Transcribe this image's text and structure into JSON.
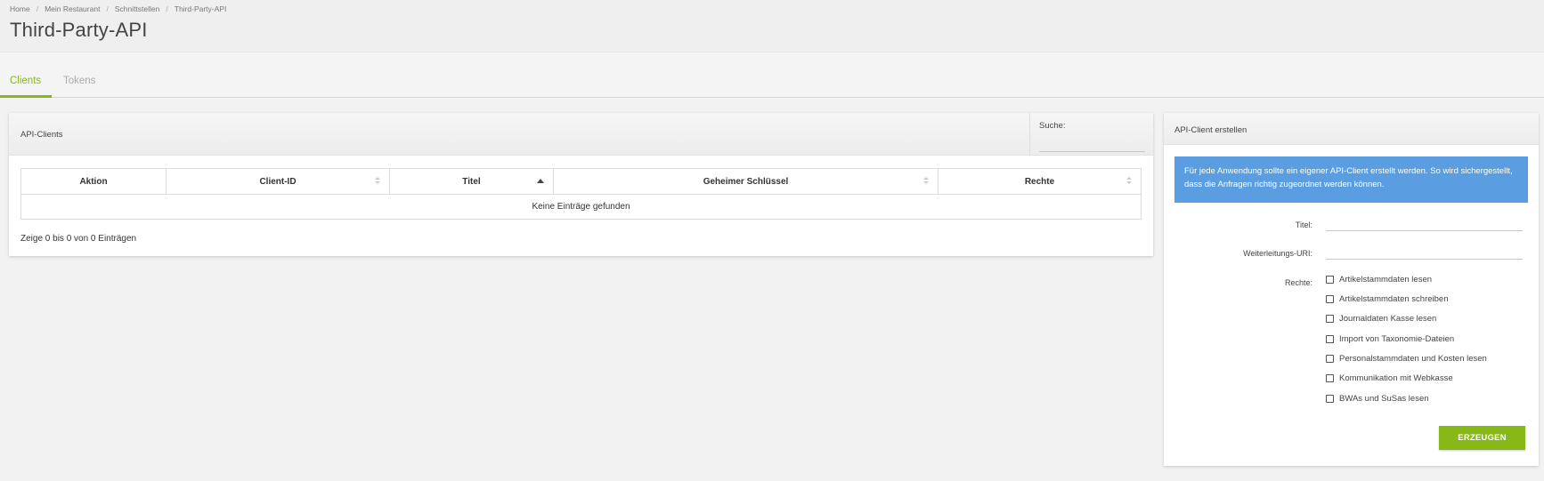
{
  "breadcrumb": {
    "items": [
      "Home",
      "Mein Restaurant",
      "Schnittstellen",
      "Third-Party-API"
    ],
    "separator": "/"
  },
  "page": {
    "title": "Third-Party-API"
  },
  "tabs": [
    {
      "label": "Clients",
      "active": true
    },
    {
      "label": "Tokens",
      "active": false
    }
  ],
  "clients_panel": {
    "title": "API-Clients",
    "search_label": "Suche:",
    "search_value": "",
    "columns": [
      "Aktion",
      "Client-ID",
      "Titel",
      "Geheimer Schlüssel",
      "Rechte"
    ],
    "sorted_column": "Titel",
    "empty_message": "Keine Einträge gefunden",
    "info": "Zeige 0 bis 0 von 0 Einträgen"
  },
  "create_panel": {
    "title": "API-Client erstellen",
    "info_text": "Für jede Anwendung sollte ein eigener API-Client erstellt werden. So wird sichergestellt, dass die Anfragen richtig zugeordnet werden können.",
    "fields": {
      "title_label": "Titel:",
      "title_value": "",
      "redirect_label": "Weiterleitungs-URI:",
      "redirect_value": "",
      "rights_label": "Rechte:"
    },
    "rights": [
      {
        "label": "Artikelstammdaten lesen",
        "checked": false
      },
      {
        "label": "Artikelstammdaten schreiben",
        "checked": false
      },
      {
        "label": "Journaldaten Kasse lesen",
        "checked": false
      },
      {
        "label": "Import von Taxonomie-Dateien",
        "checked": false
      },
      {
        "label": "Personalstammdaten und Kosten lesen",
        "checked": false
      },
      {
        "label": "Kommunikation mit Webkasse",
        "checked": false
      },
      {
        "label": "BWAs und SuSas lesen",
        "checked": false
      }
    ],
    "submit_label": "ERZEUGEN"
  },
  "colors": {
    "accent": "#86b817",
    "info": "#5a9de0",
    "background": "#f2f2f2"
  }
}
